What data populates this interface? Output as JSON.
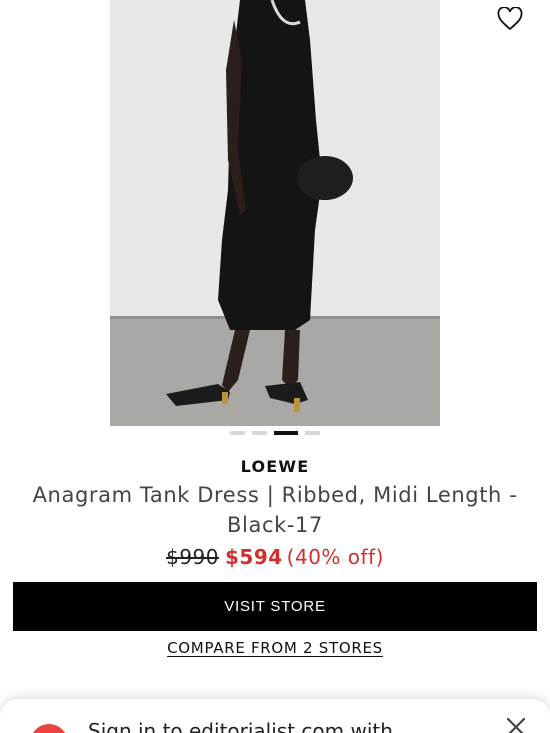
{
  "product": {
    "brand": "LOEWE",
    "name": "Anagram Tank Dress | Ribbed, Midi Length - Black-17",
    "price_original": "$990",
    "price_sale": "$594",
    "price_discount": "(40% off)"
  },
  "carousel": {
    "count": 4,
    "active_index": 2
  },
  "actions": {
    "visit_store": "VISIT STORE",
    "compare": "COMPARE FROM 2 STORES"
  },
  "signin_banner": {
    "text": "Sign in to editorialist.com with"
  },
  "icons": {
    "wishlist": "heart-icon",
    "close": "close-icon",
    "logo": "google-logo-icon"
  },
  "colors": {
    "sale": "#d12f2f",
    "button_bg": "#000000",
    "button_text": "#ffffff"
  }
}
